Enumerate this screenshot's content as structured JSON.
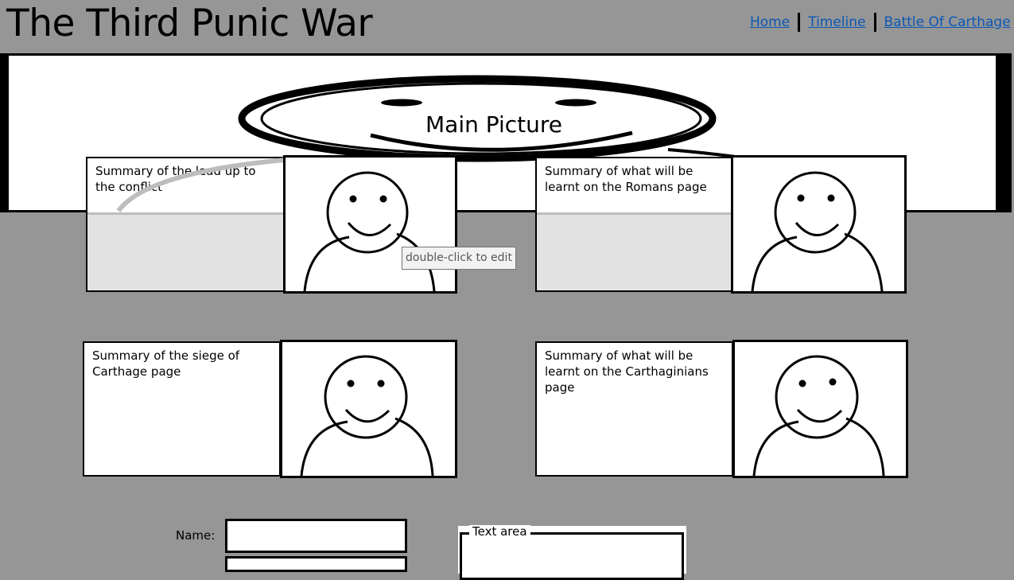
{
  "header": {
    "title": "The Third Punic War",
    "nav": [
      {
        "label": "Home"
      },
      {
        "label": "Timeline"
      },
      {
        "label": "Battle Of Carthage"
      }
    ]
  },
  "banner": {
    "label": "Main Picture",
    "image_icon": "smiley-face-icon"
  },
  "cards": [
    {
      "summary": "Summary of the lead up to the conflict",
      "image_icon": "person-placeholder-icon"
    },
    {
      "summary": "Summary of what will be learnt on the Romans page",
      "image_icon": "person-placeholder-icon"
    },
    {
      "summary": "Summary of the siege of Carthage page",
      "image_icon": "person-placeholder-icon"
    },
    {
      "summary": "Summary of what will be learnt on the Carthaginians page",
      "image_icon": "person-placeholder-icon"
    }
  ],
  "tooltip": "double-click to edit",
  "form": {
    "name_label": "Name:",
    "name_value": "",
    "textarea_label": "Text area"
  },
  "colors": {
    "background": "#969696",
    "link": "#0b57b5",
    "panel": "#ffffff"
  }
}
